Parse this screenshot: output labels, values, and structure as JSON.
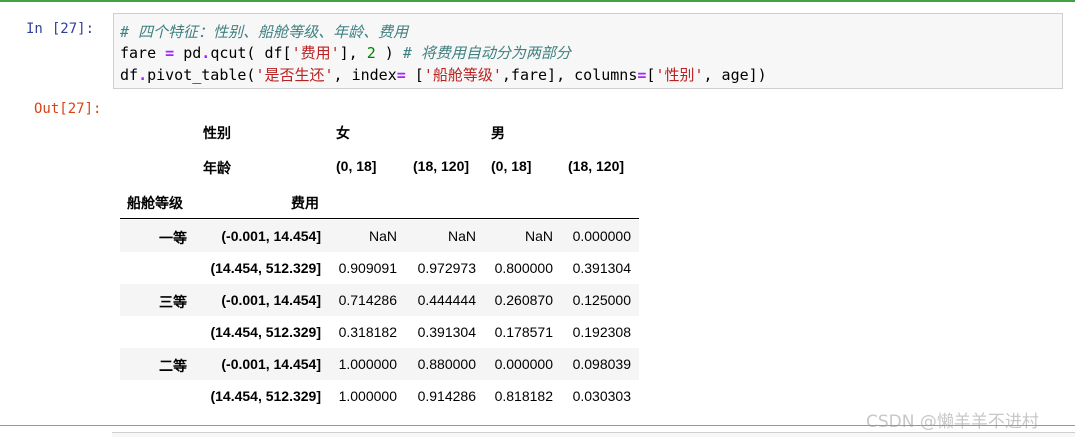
{
  "input_prompt": {
    "label": "In",
    "count": "[27]:"
  },
  "output_prompt": "Out[27]:",
  "code": {
    "line1_comment": "# 四个特征：性别、船舱等级、年龄、费用",
    "line2": [
      {
        "t": "fare ",
        "c": ""
      },
      {
        "t": "=",
        "c": "op"
      },
      {
        "t": " pd",
        "c": ""
      },
      {
        "t": ".",
        "c": "op"
      },
      {
        "t": "qcut( df[",
        "c": ""
      },
      {
        "t": "'费用'",
        "c": "str"
      },
      {
        "t": "], ",
        "c": ""
      },
      {
        "t": "2",
        "c": "num"
      },
      {
        "t": " ) ",
        "c": ""
      },
      {
        "t": "# 将费用自动分为两部分",
        "c": "cm"
      }
    ],
    "line3": [
      {
        "t": "df",
        "c": ""
      },
      {
        "t": ".",
        "c": "op"
      },
      {
        "t": "pivot_table(",
        "c": ""
      },
      {
        "t": "'是否生还'",
        "c": "str"
      },
      {
        "t": ", index",
        "c": ""
      },
      {
        "t": "=",
        "c": "op"
      },
      {
        "t": " [",
        "c": ""
      },
      {
        "t": "'船舱等级'",
        "c": "str"
      },
      {
        "t": ",fare], columns",
        "c": ""
      },
      {
        "t": "=",
        "c": "op"
      },
      {
        "t": "[",
        "c": ""
      },
      {
        "t": "'性别'",
        "c": "str"
      },
      {
        "t": ", age])",
        "c": ""
      }
    ]
  },
  "table": {
    "col_level1_name": "性别",
    "col_level2_name": "年龄",
    "sex_female": "女",
    "sex_male": "男",
    "age_bins": [
      "(0, 18]",
      "(18, 120]",
      "(0, 18]",
      "(18, 120]"
    ],
    "index_name1": "船舱等级",
    "index_name2": "费用",
    "rows": [
      {
        "class": "一等",
        "fare": "(-0.001, 14.454]",
        "values": [
          "NaN",
          "NaN",
          "NaN",
          "0.000000"
        ]
      },
      {
        "class": "",
        "fare": "(14.454, 512.329]",
        "values": [
          "0.909091",
          "0.972973",
          "0.800000",
          "0.391304"
        ]
      },
      {
        "class": "三等",
        "fare": "(-0.001, 14.454]",
        "values": [
          "0.714286",
          "0.444444",
          "0.260870",
          "0.125000"
        ]
      },
      {
        "class": "",
        "fare": "(14.454, 512.329]",
        "values": [
          "0.318182",
          "0.391304",
          "0.178571",
          "0.192308"
        ]
      },
      {
        "class": "二等",
        "fare": "(-0.001, 14.454]",
        "values": [
          "1.000000",
          "0.880000",
          "0.000000",
          "0.098039"
        ]
      },
      {
        "class": "",
        "fare": "(14.454, 512.329]",
        "values": [
          "1.000000",
          "0.914286",
          "0.818182",
          "0.030303"
        ]
      }
    ]
  },
  "watermark": "CSDN @懒羊羊不进村"
}
